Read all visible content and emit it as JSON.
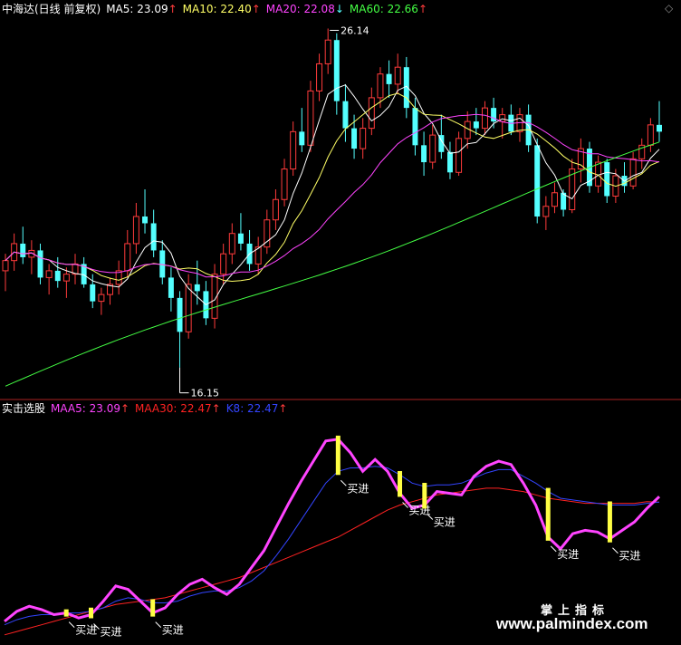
{
  "top_panel": {
    "title": "中海达(日线 前复权)",
    "ma5": "MA5: 23.09",
    "ma10": "MA10: 22.40",
    "ma20": "MA20: 22.08",
    "ma60": "MA60: 22.66",
    "ma5_arrow": "↑",
    "ma10_arrow": "↑",
    "ma20_arrow": "↓",
    "ma60_arrow": "↑",
    "corner_symbol": "◇",
    "high_label": "26.14",
    "low_label": "16.15"
  },
  "bottom_panel": {
    "title": "实击选股",
    "maa5": "MAA5: 23.09",
    "maa30": "MAA30: 22.47",
    "k8": "K8: 22.47",
    "maa5_arrow": "↑",
    "maa30_arrow": "↑",
    "k8_arrow": "↑",
    "buy_label": "买进"
  },
  "watermark": {
    "line1": "掌上指标",
    "line2": "www.palmindex.com"
  },
  "colors": {
    "background": "#000000",
    "up_candle": "#ff3b3b",
    "down_candle": "#54ffff",
    "ma5": "#ffffff",
    "ma10": "#ffff66",
    "ma20": "#ff44ff",
    "ma60": "#44ff44",
    "maa5": "#ff44ff",
    "maa30": "#ff2222",
    "k8": "#3344ff",
    "buy_bar": "#ffff44",
    "divider": "#aa2222"
  },
  "chart_data": [
    {
      "type": "candlestick",
      "title": "中海达(日线 前复权)",
      "ylim": [
        15.5,
        26.5
      ],
      "annotations": [
        {
          "text": "26.14",
          "type": "high"
        },
        {
          "text": "16.15",
          "type": "low"
        }
      ],
      "ohlc": [
        [
          19.0,
          19.5,
          18.4,
          19.3
        ],
        [
          19.3,
          20.1,
          19.0,
          19.8
        ],
        [
          19.8,
          20.3,
          19.2,
          19.4
        ],
        [
          19.4,
          19.9,
          18.9,
          19.6
        ],
        [
          19.6,
          19.8,
          18.6,
          18.8
        ],
        [
          18.8,
          19.2,
          18.3,
          19.0
        ],
        [
          19.0,
          19.4,
          18.5,
          18.7
        ],
        [
          18.7,
          19.1,
          18.2,
          18.9
        ],
        [
          18.9,
          19.5,
          18.6,
          19.2
        ],
        [
          19.2,
          19.4,
          18.5,
          18.6
        ],
        [
          18.6,
          18.9,
          17.9,
          18.1
        ],
        [
          18.1,
          18.5,
          17.7,
          18.3
        ],
        [
          18.3,
          18.8,
          18.0,
          18.6
        ],
        [
          18.6,
          19.3,
          18.3,
          19.0
        ],
        [
          19.0,
          20.2,
          18.8,
          19.8
        ],
        [
          19.8,
          21.0,
          19.5,
          20.6
        ],
        [
          20.6,
          21.4,
          20.1,
          20.4
        ],
        [
          20.4,
          20.8,
          19.4,
          19.6
        ],
        [
          19.6,
          19.9,
          18.6,
          18.8
        ],
        [
          18.8,
          19.1,
          17.8,
          18.2
        ],
        [
          18.2,
          18.4,
          16.15,
          17.2
        ],
        [
          17.2,
          18.9,
          17.0,
          18.6
        ],
        [
          18.6,
          19.3,
          18.0,
          18.4
        ],
        [
          18.4,
          18.7,
          17.4,
          17.6
        ],
        [
          17.6,
          19.2,
          17.3,
          18.9
        ],
        [
          18.9,
          19.8,
          18.6,
          19.5
        ],
        [
          19.5,
          20.4,
          19.2,
          20.1
        ],
        [
          20.1,
          20.7,
          19.6,
          19.8
        ],
        [
          19.8,
          20.2,
          19.0,
          19.2
        ],
        [
          19.2,
          20.0,
          18.9,
          19.7
        ],
        [
          19.7,
          20.8,
          19.5,
          20.5
        ],
        [
          20.5,
          21.4,
          20.2,
          21.1
        ],
        [
          21.1,
          22.3,
          20.9,
          22.0
        ],
        [
          22.0,
          23.4,
          21.8,
          23.1
        ],
        [
          23.1,
          23.8,
          22.5,
          22.7
        ],
        [
          22.7,
          24.6,
          22.5,
          24.3
        ],
        [
          24.3,
          25.4,
          24.0,
          25.1
        ],
        [
          25.1,
          26.14,
          24.8,
          25.8
        ],
        [
          25.8,
          26.0,
          23.6,
          24.0
        ],
        [
          24.0,
          24.5,
          22.8,
          23.2
        ],
        [
          23.2,
          23.6,
          22.3,
          22.6
        ],
        [
          22.6,
          23.5,
          22.3,
          23.2
        ],
        [
          23.2,
          24.4,
          23.0,
          24.1
        ],
        [
          24.1,
          25.0,
          23.8,
          24.8
        ],
        [
          24.8,
          25.2,
          24.1,
          24.5
        ],
        [
          24.5,
          25.4,
          24.2,
          25.0
        ],
        [
          25.0,
          25.3,
          23.5,
          23.8
        ],
        [
          23.8,
          24.1,
          22.4,
          22.7
        ],
        [
          22.7,
          23.1,
          21.8,
          22.2
        ],
        [
          22.2,
          23.3,
          22.0,
          23.0
        ],
        [
          23.0,
          23.6,
          22.3,
          22.5
        ],
        [
          22.5,
          22.8,
          21.7,
          21.9
        ],
        [
          21.9,
          23.1,
          21.8,
          22.9
        ],
        [
          22.9,
          23.7,
          22.6,
          23.4
        ],
        [
          23.4,
          23.8,
          23.0,
          23.2
        ],
        [
          23.2,
          24.0,
          23.0,
          23.8
        ],
        [
          23.8,
          24.1,
          23.2,
          23.4
        ],
        [
          23.4,
          23.8,
          22.9,
          23.6
        ],
        [
          23.6,
          23.9,
          23.0,
          23.1
        ],
        [
          23.1,
          23.8,
          22.8,
          23.6
        ],
        [
          23.6,
          23.9,
          22.5,
          22.7
        ],
        [
          22.7,
          22.9,
          20.4,
          20.6
        ],
        [
          20.6,
          21.2,
          20.2,
          20.9
        ],
        [
          20.9,
          21.6,
          20.7,
          21.3
        ],
        [
          21.3,
          21.4,
          20.6,
          20.8
        ],
        [
          20.8,
          22.3,
          20.7,
          22.0
        ],
        [
          22.0,
          22.9,
          21.6,
          22.6
        ],
        [
          22.6,
          22.8,
          21.3,
          21.5
        ],
        [
          21.5,
          22.4,
          21.3,
          22.2
        ],
        [
          22.2,
          22.3,
          21.0,
          21.2
        ],
        [
          21.2,
          22.0,
          21.0,
          21.8
        ],
        [
          21.8,
          22.2,
          21.3,
          21.5
        ],
        [
          21.5,
          22.5,
          21.4,
          22.3
        ],
        [
          22.3,
          22.9,
          22.0,
          22.7
        ],
        [
          22.7,
          23.5,
          22.5,
          23.3
        ],
        [
          23.3,
          24.0,
          22.8,
          23.1
        ]
      ]
    },
    {
      "type": "line",
      "title": "实击选股",
      "series": [
        {
          "name": "MAA5",
          "values": [
            15.4,
            16.0,
            16.3,
            16.1,
            15.8,
            15.9,
            15.6,
            15.8,
            16.6,
            17.5,
            17.3,
            16.6,
            15.9,
            16.2,
            17.0,
            17.6,
            17.9,
            17.4,
            17.0,
            17.6,
            18.6,
            19.6,
            21.0,
            22.4,
            23.7,
            24.9,
            26.1,
            26.2,
            25.4,
            24.3,
            25.0,
            24.3,
            23.0,
            22.1,
            22.3,
            23.1,
            23.0,
            22.9,
            24.0,
            24.6,
            24.9,
            24.7,
            23.6,
            22.3,
            20.4,
            19.7,
            20.6,
            20.8,
            20.7,
            20.3,
            20.8,
            21.3,
            22.1,
            22.8
          ]
        },
        {
          "name": "MAA30",
          "values": [
            14.6,
            14.8,
            15.0,
            15.2,
            15.4,
            15.6,
            15.8,
            16.0,
            16.2,
            16.4,
            16.5,
            16.6,
            16.7,
            16.8,
            17.0,
            17.2,
            17.4,
            17.6,
            17.8,
            18.0,
            18.3,
            18.6,
            18.9,
            19.2,
            19.5,
            19.8,
            20.1,
            20.4,
            20.8,
            21.2,
            21.6,
            22.0,
            22.3,
            22.5,
            22.7,
            22.9,
            23.0,
            23.1,
            23.2,
            23.3,
            23.3,
            23.2,
            23.1,
            22.9,
            22.7,
            22.6,
            22.5,
            22.4,
            22.4,
            22.4,
            22.4,
            22.4,
            22.5,
            22.47
          ]
        },
        {
          "name": "K8",
          "values": [
            15.2,
            15.5,
            15.7,
            15.8,
            15.8,
            15.9,
            15.9,
            16.0,
            16.2,
            16.6,
            16.8,
            16.7,
            16.5,
            16.5,
            16.6,
            16.9,
            17.1,
            17.2,
            17.2,
            17.4,
            17.8,
            18.4,
            19.3,
            20.3,
            21.4,
            22.5,
            23.6,
            24.3,
            24.5,
            24.5,
            24.6,
            24.5,
            24.1,
            23.6,
            23.4,
            23.5,
            23.5,
            23.6,
            23.9,
            24.2,
            24.4,
            24.4,
            24.0,
            23.6,
            23.1,
            22.7,
            22.6,
            22.5,
            22.4,
            22.3,
            22.3,
            22.3,
            22.4,
            22.47
          ]
        }
      ],
      "signals": [
        {
          "index": 5,
          "label": "买进"
        },
        {
          "index": 7,
          "label": "买进"
        },
        {
          "index": 12,
          "label": "买进"
        },
        {
          "index": 27,
          "label": "买进"
        },
        {
          "index": 32,
          "label": "买进"
        },
        {
          "index": 34,
          "label": "买进"
        },
        {
          "index": 44,
          "label": "买进"
        },
        {
          "index": 49,
          "label": "买进"
        }
      ]
    }
  ]
}
